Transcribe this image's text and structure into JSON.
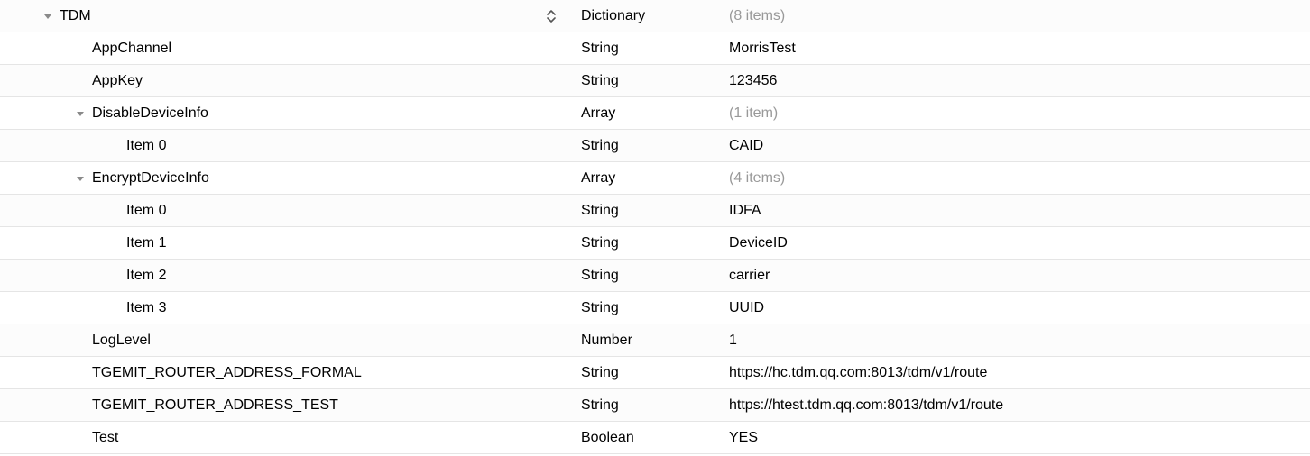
{
  "rows": [
    {
      "indent": 0,
      "arrow": true,
      "key": "TDM",
      "type": "Dictionary",
      "value": "(8 items)",
      "placeholder": true,
      "sortArrows": true
    },
    {
      "indent": 1,
      "arrow": false,
      "key": "AppChannel",
      "type": "String",
      "value": "MorrisTest",
      "placeholder": false
    },
    {
      "indent": 1,
      "arrow": false,
      "key": "AppKey",
      "type": "String",
      "value": "123456",
      "placeholder": false
    },
    {
      "indent": 1,
      "arrow": true,
      "key": "DisableDeviceInfo",
      "type": "Array",
      "value": "(1 item)",
      "placeholder": true
    },
    {
      "indent": 2,
      "arrow": false,
      "key": "Item 0",
      "type": "String",
      "value": "CAID",
      "placeholder": false
    },
    {
      "indent": 1,
      "arrow": true,
      "key": "EncryptDeviceInfo",
      "type": "Array",
      "value": "(4 items)",
      "placeholder": true
    },
    {
      "indent": 2,
      "arrow": false,
      "key": "Item 0",
      "type": "String",
      "value": "IDFA",
      "placeholder": false
    },
    {
      "indent": 2,
      "arrow": false,
      "key": "Item 1",
      "type": "String",
      "value": "DeviceID",
      "placeholder": false
    },
    {
      "indent": 2,
      "arrow": false,
      "key": "Item 2",
      "type": "String",
      "value": "carrier",
      "placeholder": false
    },
    {
      "indent": 2,
      "arrow": false,
      "key": "Item 3",
      "type": "String",
      "value": "UUID",
      "placeholder": false
    },
    {
      "indent": 1,
      "arrow": false,
      "key": "LogLevel",
      "type": "Number",
      "value": "1",
      "placeholder": false
    },
    {
      "indent": 1,
      "arrow": false,
      "key": "TGEMIT_ROUTER_ADDRESS_FORMAL",
      "type": "String",
      "value": "https://hc.tdm.qq.com:8013/tdm/v1/route",
      "placeholder": false
    },
    {
      "indent": 1,
      "arrow": false,
      "key": "TGEMIT_ROUTER_ADDRESS_TEST",
      "type": "String",
      "value": "https://htest.tdm.qq.com:8013/tdm/v1/route",
      "placeholder": false
    },
    {
      "indent": 1,
      "arrow": false,
      "key": "Test",
      "type": "Boolean",
      "value": "YES",
      "placeholder": false
    }
  ]
}
